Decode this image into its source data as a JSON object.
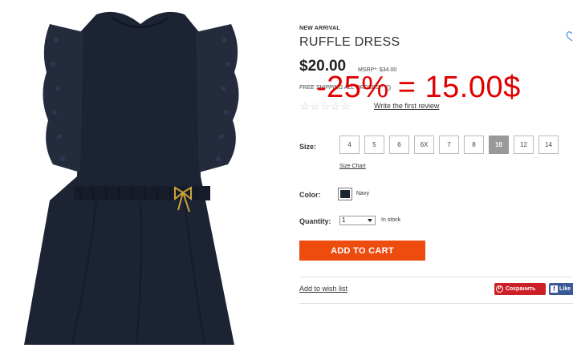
{
  "product": {
    "badge": "NEW ARRIVAL",
    "title": "RUFFLE DRESS",
    "price": "$20.00",
    "msrp": "MSRP*: $34.00",
    "shipping": "FREE SHIPPING ALL ORDERS!*",
    "discount_overlay": "-25% = 15.00$",
    "review_link": "Write the first review",
    "rating_stars": "☆☆☆☆☆"
  },
  "size": {
    "label": "Size:",
    "options": [
      "4",
      "5",
      "6",
      "6X",
      "7",
      "8",
      "10",
      "12",
      "14"
    ],
    "selected": "10",
    "chart_link": "Size Chart"
  },
  "color": {
    "label": "Color:",
    "name": "Navy",
    "swatch_hex": "#1c2333"
  },
  "quantity": {
    "label": "Quantity:",
    "value": "1",
    "stock": "In stock"
  },
  "actions": {
    "add_to_cart": "ADD TO CART",
    "wishlist": "Add to wish list",
    "pinterest": "Сохранить",
    "facebook": "Like"
  },
  "colors": {
    "accent": "#ee4b0f",
    "discount_red": "#e00000",
    "pinterest": "#cb2027",
    "facebook": "#3b5998",
    "dress": "#1c2333"
  },
  "icons": {
    "favorite": "heart-icon",
    "pinterest": "pinterest-icon",
    "facebook": "facebook-icon",
    "info": "info-icon"
  }
}
